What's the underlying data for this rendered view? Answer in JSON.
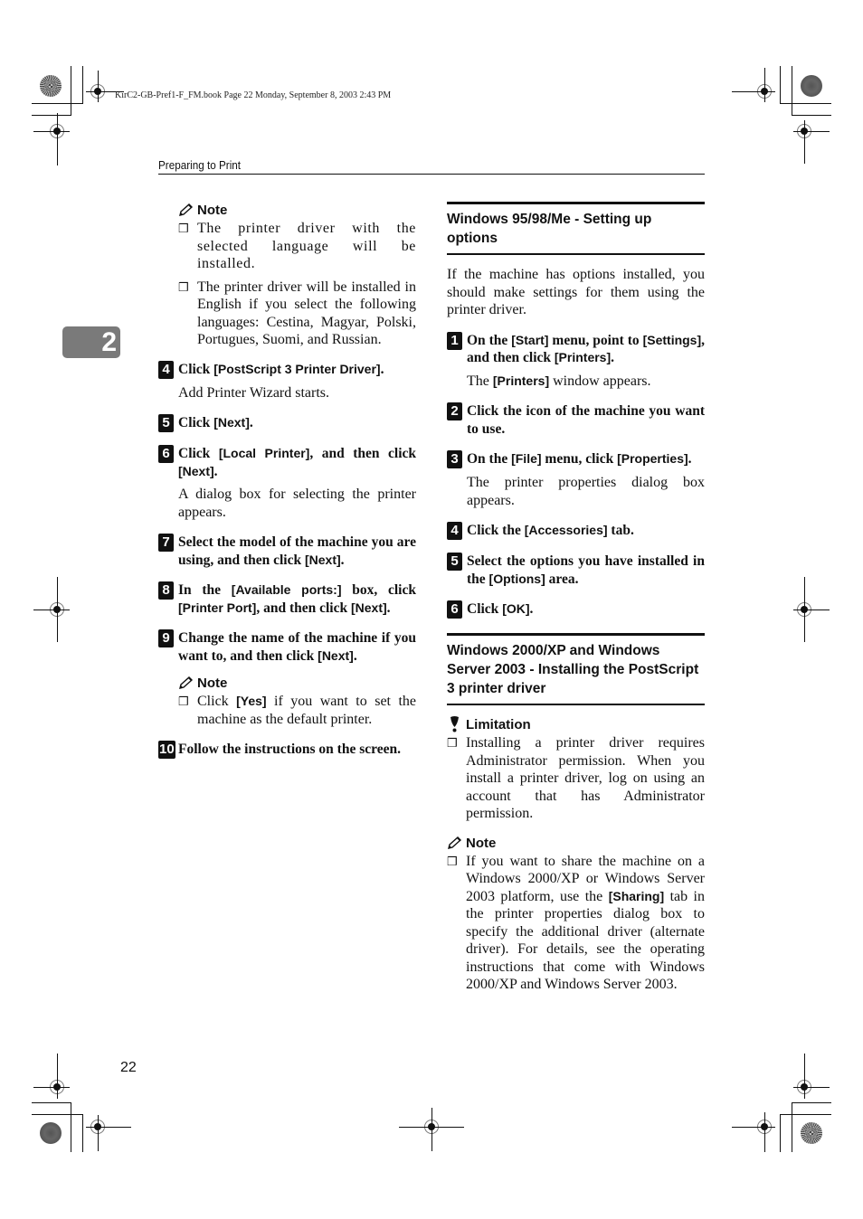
{
  "file_meta": "KirC2-GB-Pref1-F_FM.book  Page 22  Monday, September 8, 2003  2:43 PM",
  "running_head": "Preparing to Print",
  "chapter_tab": "2",
  "page_number": "22",
  "left": {
    "note1": {
      "title": "Note",
      "items": [
        "The printer driver with the selected language will be installed.",
        "The printer driver will be installed in English if you select the following languages: Cestina, Magyar, Polski, Portugues, Suomi, and Russian."
      ]
    },
    "steps": [
      {
        "num": "4",
        "parts": [
          {
            "t": "Click "
          },
          {
            "k": "[PostScript 3 Printer Driver]"
          },
          {
            "t": "."
          }
        ],
        "result": "Add Printer Wizard starts."
      },
      {
        "num": "5",
        "parts": [
          {
            "t": "Click "
          },
          {
            "k": "[Next]"
          },
          {
            "t": "."
          }
        ]
      },
      {
        "num": "6",
        "parts": [
          {
            "t": "Click "
          },
          {
            "k": "[Local Printer]"
          },
          {
            "t": ", and then click "
          },
          {
            "k": "[Next]"
          },
          {
            "t": "."
          }
        ],
        "result": "A dialog box for selecting the printer appears."
      },
      {
        "num": "7",
        "parts": [
          {
            "t": "Select the model of the machine you are using, and then click "
          },
          {
            "k": "[Next]"
          },
          {
            "t": "."
          }
        ]
      },
      {
        "num": "8",
        "parts": [
          {
            "t": "In the "
          },
          {
            "k": "[Available ports:]"
          },
          {
            "t": " box, click "
          },
          {
            "k": "[Printer Port]"
          },
          {
            "t": ", and then click "
          },
          {
            "k": "[Next]"
          },
          {
            "t": "."
          }
        ]
      },
      {
        "num": "9",
        "parts": [
          {
            "t": "Change the name of the machine if you want to, and then click "
          },
          {
            "k": "[Next]"
          },
          {
            "t": "."
          }
        ]
      },
      {
        "num": "10",
        "parts": [
          {
            "t": "Follow the instructions on the screen."
          }
        ]
      }
    ],
    "note2": {
      "title": "Note",
      "items_parts": [
        [
          {
            "t": "Click "
          },
          {
            "k": "[Yes]"
          },
          {
            "t": " if you want to set the machine as the default printer."
          }
        ]
      ]
    }
  },
  "right": {
    "section1": {
      "title": "Windows 95/98/Me - Setting up options",
      "intro": "If the machine has options installed, you should make settings for them using the printer driver.",
      "steps": [
        {
          "num": "1",
          "parts": [
            {
              "t": "On the "
            },
            {
              "k": "[Start]"
            },
            {
              "t": " menu, point to "
            },
            {
              "k": "[Settings]"
            },
            {
              "t": ", and then click "
            },
            {
              "k": "[Printers]"
            },
            {
              "t": "."
            }
          ],
          "result_parts": [
            {
              "t": "The "
            },
            {
              "k": "[Printers]"
            },
            {
              "t": " window appears."
            }
          ]
        },
        {
          "num": "2",
          "parts": [
            {
              "t": "Click the icon of the machine you want to use."
            }
          ]
        },
        {
          "num": "3",
          "parts": [
            {
              "t": "On the "
            },
            {
              "k": "[File]"
            },
            {
              "t": " menu, click "
            },
            {
              "k": "[Properties]"
            },
            {
              "t": "."
            }
          ],
          "result_parts": [
            {
              "t": "The printer properties dialog box appears."
            }
          ]
        },
        {
          "num": "4",
          "parts": [
            {
              "t": "Click the "
            },
            {
              "k": "[Accessories]"
            },
            {
              "t": " tab."
            }
          ]
        },
        {
          "num": "5",
          "parts": [
            {
              "t": "Select the options you have installed in the "
            },
            {
              "k": "[Options]"
            },
            {
              "t": " area."
            }
          ]
        },
        {
          "num": "6",
          "parts": [
            {
              "t": "Click "
            },
            {
              "k": "[OK]"
            },
            {
              "t": "."
            }
          ]
        }
      ]
    },
    "section2": {
      "title": "Windows 2000/XP and Windows Server 2003 - Installing the PostScript 3 printer driver",
      "limitation": {
        "title": "Limitation",
        "items": [
          "Installing a printer driver requires Administrator permission. When you install a printer driver, log on using an account that has Administrator permission."
        ]
      },
      "note": {
        "title": "Note",
        "items_parts": [
          [
            {
              "t": "If you want to share the machine on a Windows 2000/XP or Windows Server 2003 platform, use the "
            },
            {
              "k": "[Sharing]"
            },
            {
              "t": " tab in the printer properties dialog box to specify the additional driver (alternate driver). For details, see the operating instructions that come with Windows 2000/XP and Windows Server 2003."
            }
          ]
        ]
      }
    }
  }
}
